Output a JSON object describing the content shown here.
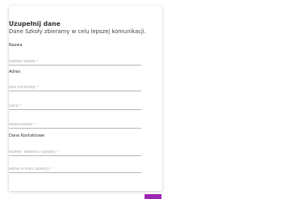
{
  "form": {
    "title": "Uzupełnij dane",
    "subtitle": "Dane Szkoły zbieramy w celu lepszej komunikacji.",
    "sections": {
      "name": "Nazwa",
      "address": "Adres",
      "contact": "Dane Kontaktowe"
    },
    "fields": {
      "school_name": {
        "placeholder": "Nazwa Szkoły *",
        "value": ""
      },
      "postal_code": {
        "placeholder": "Kod Pocztowy *",
        "value": ""
      },
      "street": {
        "placeholder": "Ulica *",
        "value": ""
      },
      "city": {
        "placeholder": "Miejscowość *",
        "value": ""
      },
      "phone": {
        "placeholder": "Numer Telefonu (szkoły) *",
        "value": ""
      },
      "email": {
        "placeholder": "Adres e-mail (szkoły) *",
        "value": ""
      }
    },
    "submit_color": "#9c27b0"
  }
}
